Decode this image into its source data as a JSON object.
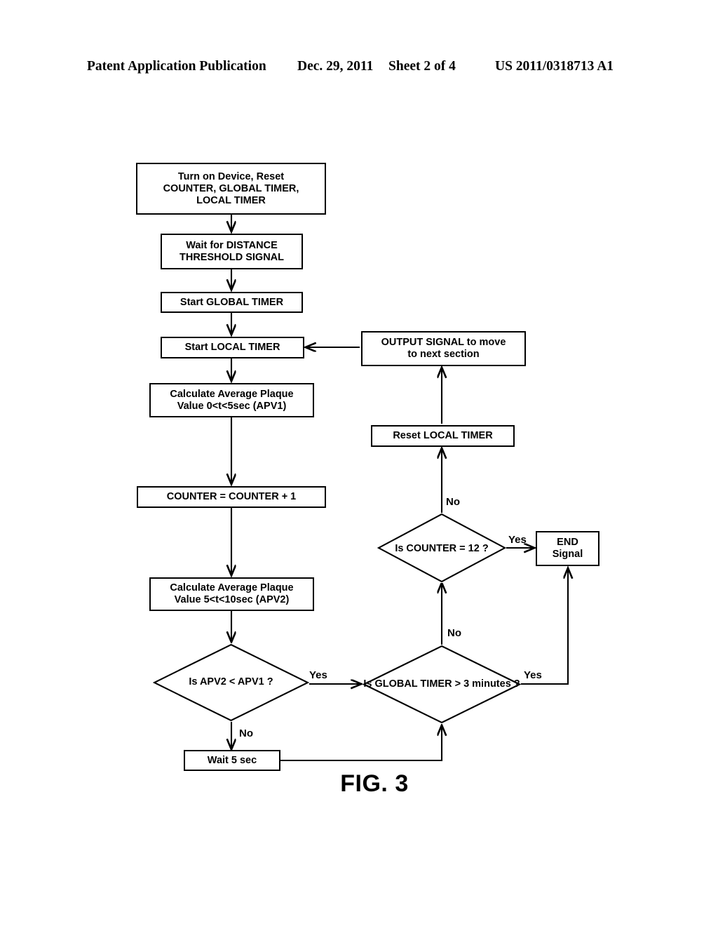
{
  "header": {
    "left": "Patent Application Publication",
    "date": "Dec. 29, 2011",
    "sheet": "Sheet 2 of 4",
    "publication_number": "US 2011/0318713 A1"
  },
  "figure": {
    "caption": "FIG. 3"
  },
  "nodes": {
    "turn_on": {
      "line1": "Turn on Device, Reset",
      "line2": "COUNTER, GLOBAL TIMER,",
      "line3": "LOCAL TIMER"
    },
    "wait_distance": {
      "line1": "Wait for DISTANCE",
      "line2": "THRESHOLD SIGNAL"
    },
    "start_global": {
      "line1": "Start GLOBAL TIMER"
    },
    "start_local": {
      "line1": "Start LOCAL TIMER"
    },
    "calc_apv1": {
      "line1": "Calculate Average Plaque",
      "line2": "Value 0<t<5sec (APV1)"
    },
    "counter_inc": {
      "line1": "COUNTER = COUNTER + 1"
    },
    "calc_apv2": {
      "line1": "Calculate Average Plaque",
      "line2": "Value 5<t<10sec (APV2)"
    },
    "output_signal": {
      "line1": "OUTPUT SIGNAL to move",
      "line2": "to next section"
    },
    "reset_local": {
      "line1": "Reset LOCAL TIMER"
    },
    "end_signal": {
      "line1": "END",
      "line2": "Signal"
    },
    "wait_5sec": {
      "line1": "Wait 5 sec"
    },
    "decision_apv": {
      "line1": "Is APV2",
      "line2": "< APV1",
      "line3": "?"
    },
    "decision_counter": {
      "line1": "Is COUNTER = 12",
      "line2": "?"
    },
    "decision_global": {
      "line1": "Is GLOBAL TIMER",
      "line2": "> 3 minutes",
      "line3": "?"
    }
  },
  "edge_labels": {
    "apv_yes": "Yes",
    "apv_no": "No",
    "global_yes": "Yes",
    "global_no": "No",
    "counter_yes": "Yes",
    "counter_no": "No"
  },
  "colors": {
    "stroke": "#000000",
    "fill": "#ffffff",
    "background": "#ffffff"
  }
}
